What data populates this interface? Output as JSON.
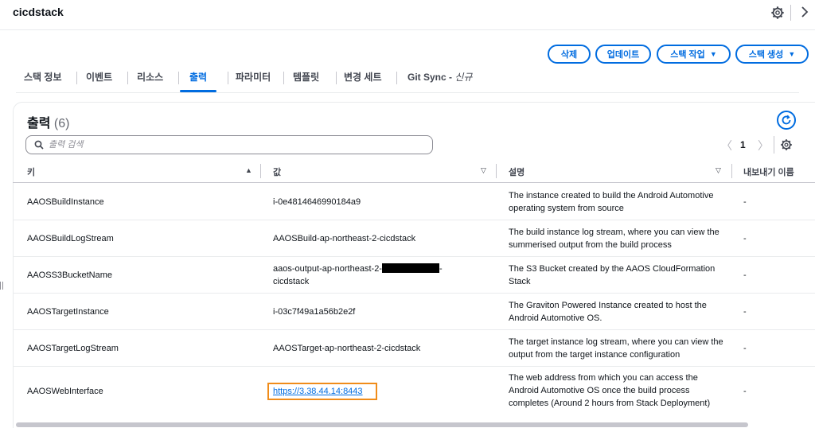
{
  "header": {
    "title": "cicdstack",
    "settings_icon": "gear-icon",
    "collapse_icon": "chevron-right-icon"
  },
  "actions": {
    "delete": "삭제",
    "update": "업데이트",
    "stack_actions": "스택 작업",
    "create_stack": "스택 생성"
  },
  "tabs": [
    {
      "label": "스택 정보"
    },
    {
      "label": "이벤트"
    },
    {
      "label": "리소스"
    },
    {
      "label": "출력"
    },
    {
      "label": "파라미터"
    },
    {
      "label": "템플릿"
    },
    {
      "label": "변경 세트"
    },
    {
      "label": "Git Sync - ",
      "suffix": "신규"
    }
  ],
  "active_tab": "출력",
  "outputs": {
    "title": "출력",
    "count": "(6)",
    "search_placeholder": "출력 검색",
    "page": "1",
    "columns": {
      "key": "키",
      "value": "값",
      "description": "설명",
      "export": "내보내기 이름"
    },
    "rows": [
      {
        "key": "AAOSBuildInstance",
        "value": "i-0e4814646990184a9",
        "description": "The instance created to build the Android Automotive operating system from source",
        "export": "-"
      },
      {
        "key": "AAOSBuildLogStream",
        "value": "AAOSBuild-ap-northeast-2-cicdstack",
        "description": "The build instance log stream, where you can view the summerised output from the build process",
        "export": "-"
      },
      {
        "key": "AAOSS3BucketName",
        "value_a": "aaos-output-ap-northeast-2-",
        "value_b": "-",
        "value_c": "cicdstack",
        "description": "The S3 Bucket created by the AAOS CloudFormation Stack",
        "export": "-"
      },
      {
        "key": "AAOSTargetInstance",
        "value": "i-03c7f49a1a56b2e2f",
        "description": "The Graviton Powered Instance created to host the Android Automotive OS.",
        "export": "-"
      },
      {
        "key": "AAOSTargetLogStream",
        "value": "AAOSTarget-ap-northeast-2-cicdstack",
        "description": "The target instance log stream, where you can view the output from the target instance configuration",
        "export": "-"
      },
      {
        "key": "AAOSWebInterface",
        "value": "https://3.38.44.14:8443",
        "description": "The web address from which you can access the Android Automotive OS once the build process completes (Around 2 hours from Stack Deployment)",
        "export": "-"
      }
    ]
  },
  "colors": {
    "accent": "#006ce0",
    "highlight": "#f08c1a",
    "text": "#0f141a"
  }
}
